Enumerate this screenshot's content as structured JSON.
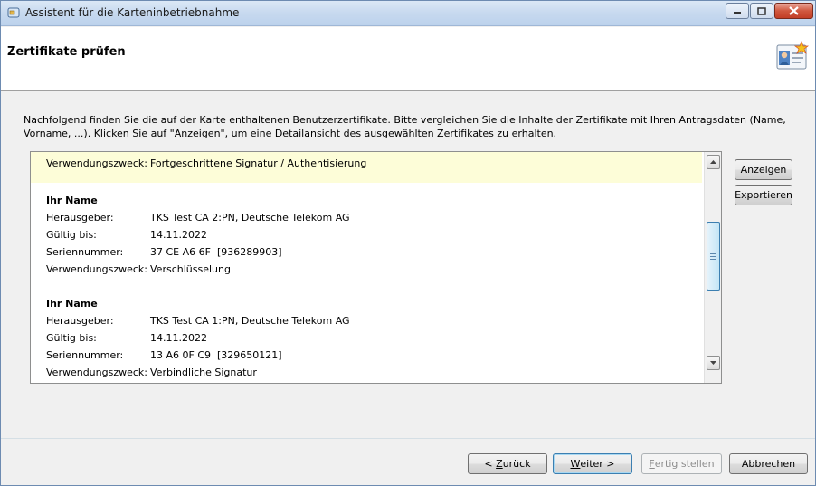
{
  "window": {
    "title": "Assistent für die Karteninbetriebnahme"
  },
  "header": {
    "title": "Zertifikate prüfen"
  },
  "intro": {
    "text": "Nachfolgend finden Sie die auf der Karte enthaltenen Benutzerzertifikate. Bitte vergleichen Sie die Inhalte der Zertifikate mit Ihren Antragsdaten (Name, Vorname, ...). Klicken Sie auf \"Anzeigen\", um eine Detailansicht des ausgewählten Zertifikates zu erhalten."
  },
  "labels": {
    "issuer": "Herausgeber:",
    "valid_until": "Gültig bis:",
    "serial": "Seriennummer:",
    "purpose": "Verwendungszweck:"
  },
  "certificates": {
    "selected_purpose": "Fortgeschrittene Signatur / Authentisierung",
    "items": [
      {
        "name": "Ihr Name",
        "issuer": "TKS Test CA 2:PN, Deutsche Telekom AG",
        "valid_until": "14.11.2022",
        "serial": "37 CE A6 6F  [936289903]",
        "purpose": "Verschlüsselung"
      },
      {
        "name": "Ihr Name",
        "issuer": "TKS Test CA 1:PN, Deutsche Telekom AG",
        "valid_until": "14.11.2022",
        "serial": "13 A6 0F C9  [329650121]",
        "purpose": "Verbindliche Signatur"
      }
    ]
  },
  "side_buttons": {
    "show": "Anzeigen",
    "export": "Exportieren"
  },
  "footer": {
    "back_pre": "< ",
    "back_key": "Z",
    "back_post": "urück",
    "next_key": "W",
    "next_post": "eiter >",
    "finish_key": "F",
    "finish_post": "ertig stellen",
    "cancel": "Abbrechen"
  },
  "colors": {
    "highlight": "#fdfdd8",
    "accent": "#3c7fb1"
  }
}
